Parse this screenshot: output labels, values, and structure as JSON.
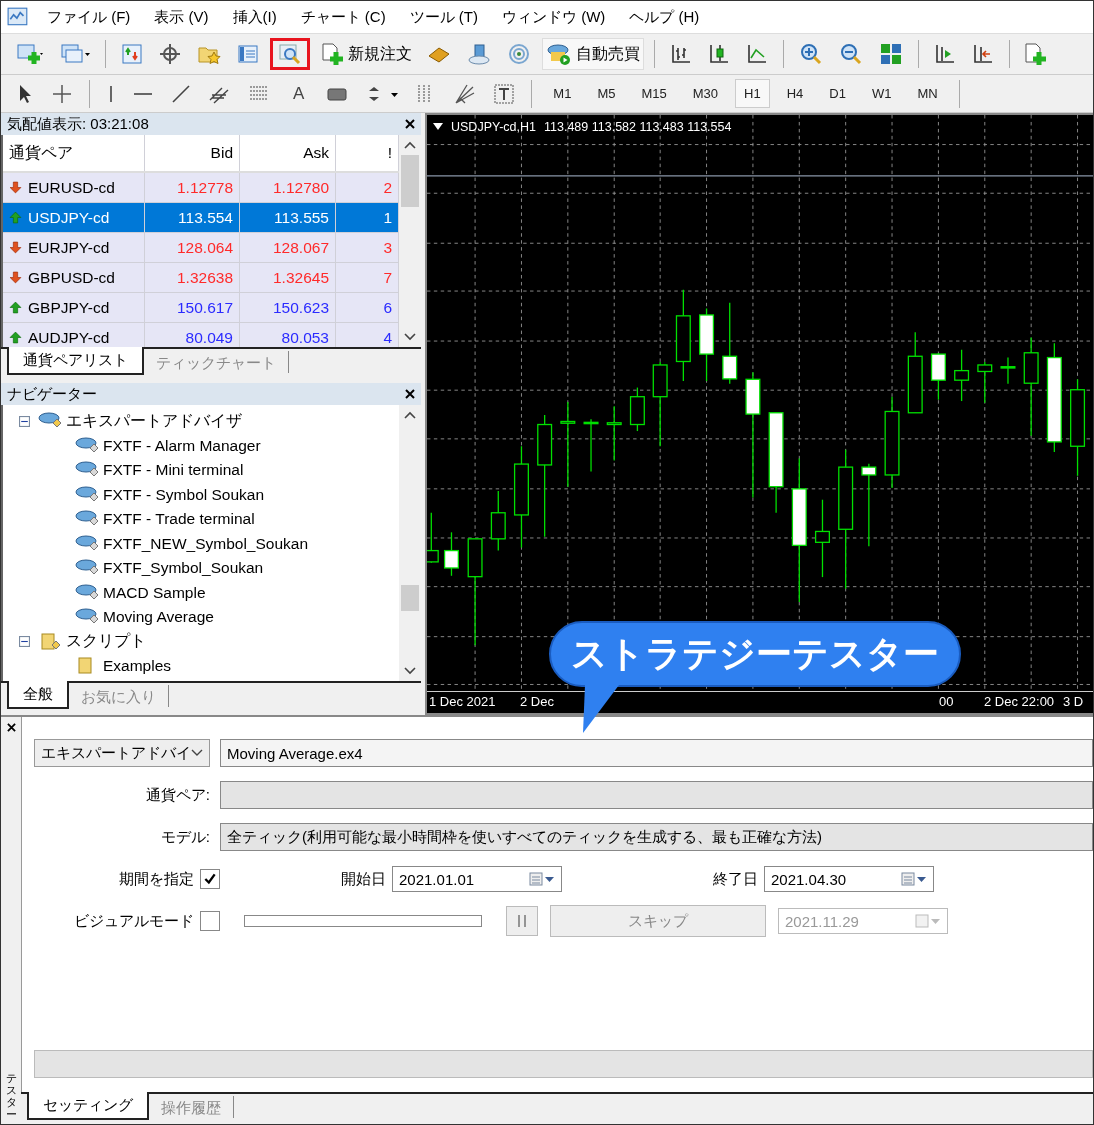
{
  "menu": [
    "ファイル (F)",
    "表示 (V)",
    "挿入(I)",
    "チャート (C)",
    "ツール (T)",
    "ウィンドウ (W)",
    "ヘルプ (H)"
  ],
  "toolbar": {
    "new_order": "新規注文",
    "auto_trading": "自動売買",
    "tester_highlighted": true
  },
  "drawing_tools": {
    "text_tool": "A"
  },
  "timeframes": [
    {
      "label": "M1",
      "selected": false
    },
    {
      "label": "M5",
      "selected": false
    },
    {
      "label": "M15",
      "selected": false
    },
    {
      "label": "M30",
      "selected": false
    },
    {
      "label": "H1",
      "selected": true
    },
    {
      "label": "H4",
      "selected": false
    },
    {
      "label": "D1",
      "selected": false
    },
    {
      "label": "W1",
      "selected": false
    },
    {
      "label": "MN",
      "selected": false
    }
  ],
  "market_watch": {
    "title": "気配値表示: 03:21:08",
    "columns": [
      "通貨ペア",
      "Bid",
      "Ask",
      "!"
    ],
    "rows": [
      {
        "symbol": "EURUSD-cd",
        "bid": "1.12778",
        "ask": "1.12780",
        "spread": "2",
        "rising": false,
        "selected": false
      },
      {
        "symbol": "USDJPY-cd",
        "bid": "113.554",
        "ask": "113.555",
        "spread": "1",
        "rising": true,
        "selected": true
      },
      {
        "symbol": "EURJPY-cd",
        "bid": "128.064",
        "ask": "128.067",
        "spread": "3",
        "rising": false,
        "selected": false
      },
      {
        "symbol": "GBPUSD-cd",
        "bid": "1.32638",
        "ask": "1.32645",
        "spread": "7",
        "rising": false,
        "selected": false
      },
      {
        "symbol": "GBPJPY-cd",
        "bid": "150.617",
        "ask": "150.623",
        "spread": "6",
        "rising": true,
        "selected": false
      },
      {
        "symbol": "AUDJPY-cd",
        "bid": "80.049",
        "ask": "80.053",
        "spread": "4",
        "rising": true,
        "selected": false
      }
    ],
    "tabs": [
      {
        "label": "通貨ペアリスト",
        "selected": true
      },
      {
        "label": "ティックチャート",
        "selected": false
      }
    ]
  },
  "navigator": {
    "title": "ナビゲーター",
    "tree": [
      {
        "label": "エキスパートアドバイザ",
        "kind": "experts",
        "expanded": true,
        "children": [
          {
            "label": "FXTF - Alarm Manager",
            "kind": "expert"
          },
          {
            "label": "FXTF - Mini terminal",
            "kind": "expert"
          },
          {
            "label": "FXTF - Symbol Soukan",
            "kind": "expert"
          },
          {
            "label": "FXTF - Trade terminal",
            "kind": "expert"
          },
          {
            "label": "FXTF_NEW_Symbol_Soukan",
            "kind": "expert"
          },
          {
            "label": "FXTF_Symbol_Soukan",
            "kind": "expert"
          },
          {
            "label": "MACD Sample",
            "kind": "expert"
          },
          {
            "label": "Moving Average",
            "kind": "expert"
          }
        ]
      },
      {
        "label": "スクリプト",
        "kind": "scripts",
        "expanded": true,
        "children": [
          {
            "label": "Examples",
            "kind": "script-folder"
          }
        ]
      }
    ],
    "tabs": [
      {
        "label": "全般",
        "selected": true
      },
      {
        "label": "お気に入り",
        "selected": false
      }
    ]
  },
  "chart": {
    "symbol": "USDJPY-cd,H1",
    "prices": "113.489 113.582 113.483 113.554",
    "time_labels": [
      "1 Dec 2021",
      "2 Dec",
      "00",
      "2 Dec 22:00",
      "3 D"
    ]
  },
  "callout": "ストラテジーテスター",
  "tester": {
    "side_label": "テスター",
    "expert_type": "エキスパートアドバイ",
    "expert_file": "Moving Average.ex4",
    "symbol_label": "通貨ペア:",
    "model_label": "モデル:",
    "model": "全ティック(利用可能な最小時間枠を使いすべてのティックを生成する、最も正確な方法)",
    "use_date_label": "期間を指定",
    "use_date": true,
    "from_label": "開始日",
    "from": "2021.01.01",
    "to_label": "終了日",
    "to": "2021.04.30",
    "visual_label": "ビジュアルモード",
    "visual": false,
    "skip_button": "スキップ",
    "skip_to": "2021.11.29",
    "speed": {
      "level": 0
    },
    "progress": {
      "level": 0
    },
    "tabs": [
      {
        "label": "セッティング",
        "selected": true
      },
      {
        "label": "操作履歴",
        "selected": false
      }
    ]
  }
}
